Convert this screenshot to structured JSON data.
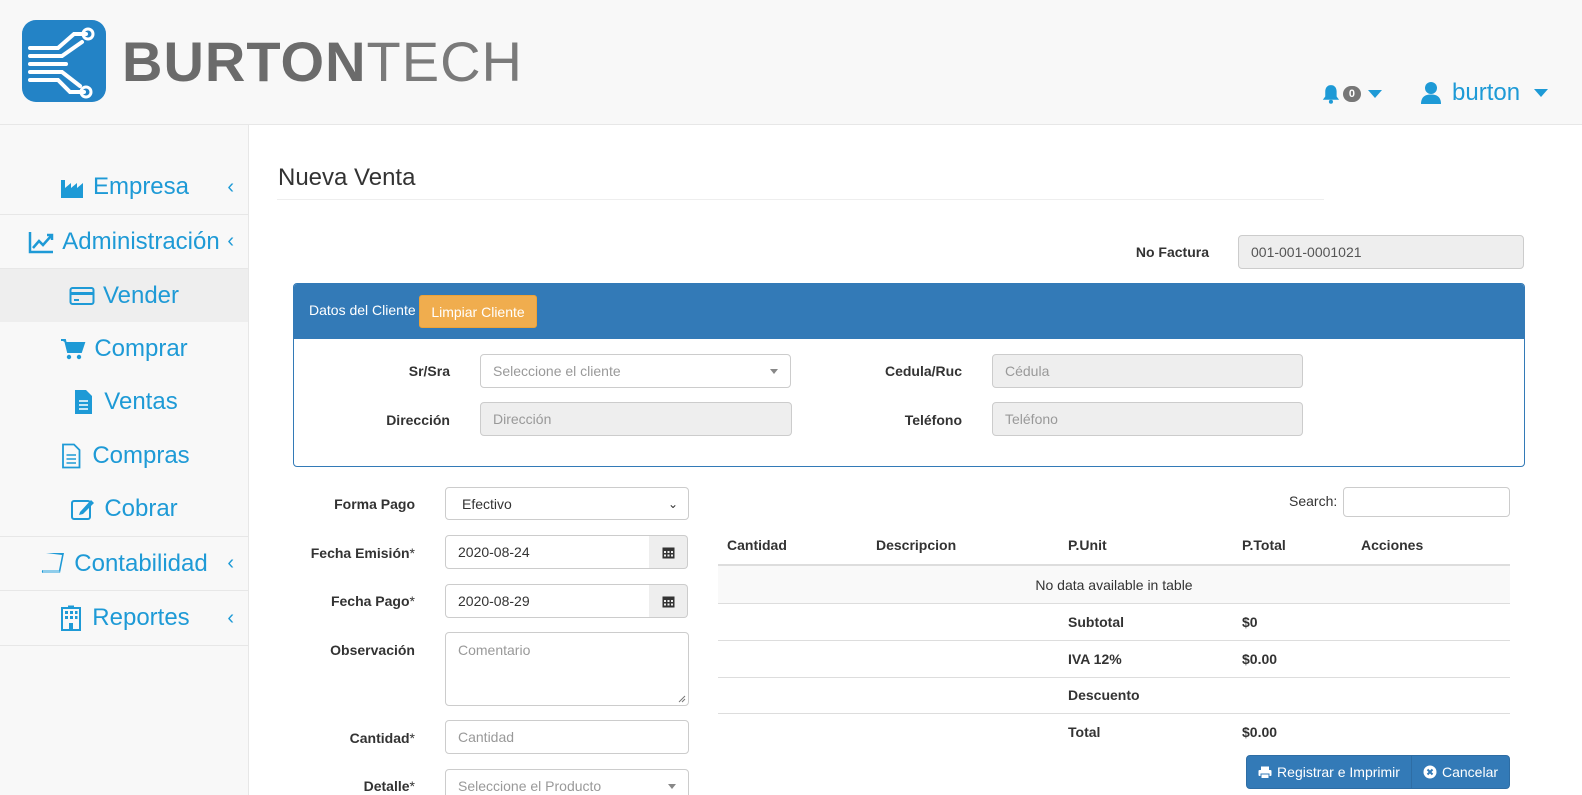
{
  "brand": {
    "bold": "BURTON",
    "light": "TECH",
    "logo_color": "#1e9ad6"
  },
  "header": {
    "notifications_count": "0",
    "user_name": "burton"
  },
  "sidebar": {
    "items": [
      {
        "label": "Empresa",
        "icon": "industry-icon"
      },
      {
        "label": "Administración",
        "icon": "line-chart-icon"
      },
      {
        "label": "Vender",
        "icon": "credit-card-icon"
      },
      {
        "label": "Comprar",
        "icon": "cart-icon"
      },
      {
        "label": "Ventas",
        "icon": "file-text-icon"
      },
      {
        "label": "Compras",
        "icon": "file-outline-icon"
      },
      {
        "label": "Cobrar",
        "icon": "edit-icon"
      },
      {
        "label": "Contabilidad",
        "icon": "book-icon"
      },
      {
        "label": "Reportes",
        "icon": "building-icon"
      }
    ]
  },
  "page": {
    "title": "Nueva Venta"
  },
  "invoice": {
    "label": "No Factura",
    "value": "001-001-0001021"
  },
  "client_panel": {
    "title": "Datos del Cliente",
    "clear_button": "Limpiar Cliente",
    "client_label": "Sr/Sra",
    "client_placeholder": "Seleccione el cliente",
    "id_label": "Cedula/Ruc",
    "id_placeholder": "Cédula",
    "address_label": "Dirección",
    "address_placeholder": "Dirección",
    "phone_label": "Teléfono",
    "phone_placeholder": "Teléfono"
  },
  "form": {
    "payment_label": "Forma Pago",
    "payment_value": "Efectivo",
    "issue_date_label": "Fecha Emisión",
    "issue_date_value": "2020-08-24",
    "pay_date_label": "Fecha Pago",
    "pay_date_value": "2020-08-29",
    "observation_label": "Observación",
    "observation_placeholder": "Comentario",
    "quantity_label": "Cantidad",
    "quantity_placeholder": "Cantidad",
    "detail_label": "Detalle",
    "detail_placeholder": "Seleccione el Producto",
    "required_mark": "*"
  },
  "table": {
    "search_label": "Search:",
    "columns": [
      "Cantidad",
      "Descripcion",
      "P.Unit",
      "P.Total",
      "Acciones"
    ],
    "empty_message": "No data available in table",
    "totals": [
      {
        "label": "Subtotal",
        "value": "$0"
      },
      {
        "label": "IVA 12%",
        "value": "$0.00"
      },
      {
        "label": "Descuento",
        "value": ""
      },
      {
        "label": "Total",
        "value": "$0.00"
      }
    ]
  },
  "actions": {
    "register_print": "Registrar e Imprimir",
    "cancel": "Cancelar"
  }
}
